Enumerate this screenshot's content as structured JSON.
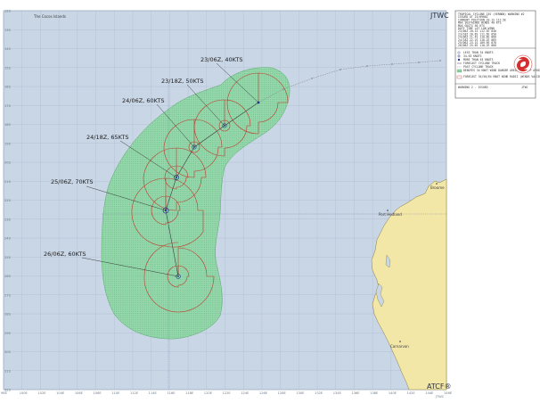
{
  "header": {
    "agency": "JTWC",
    "footer_brand": "ATCF®",
    "footer_sub": "JTWC",
    "region": "The Cocos Islands"
  },
  "colors": {
    "ocean": "#c9d6e6",
    "grid": "#a9b8cc",
    "land": "#f3e7a7",
    "wind_area": "#5fd07a",
    "forecast_track": "#3a3a3a",
    "past_track": "#8a8f96",
    "wind_radii": "#c0392b",
    "storm_marker": "#1e3a8a",
    "logo_red": "#d32f2f"
  },
  "forecast_points": [
    {
      "label": "23/06Z, 40KTS"
    },
    {
      "label": "23/18Z, 50KTS"
    },
    {
      "label": "24/06Z, 60KTS"
    },
    {
      "label": "24/18Z, 65KTS"
    },
    {
      "label": "25/06Z, 70KTS"
    },
    {
      "label": "26/06Z, 60KTS"
    }
  ],
  "places": {
    "port_hedland": "Port Hedland",
    "carnarvon": "Carnarvon",
    "broome": "Broome"
  },
  "lon_ticks": [
    "98E",
    "100E",
    "102E",
    "104E",
    "106E",
    "108E",
    "110E",
    "112E",
    "114E",
    "116E",
    "118E",
    "120E",
    "122E",
    "124E",
    "126E",
    "128E",
    "130E",
    "132E",
    "134E",
    "136E",
    "138E",
    "140E",
    "142E",
    "144E",
    "146E"
  ],
  "lat_ticks": [
    "12S",
    "13S",
    "14S",
    "15S",
    "16S",
    "17S",
    "18S",
    "19S",
    "20S",
    "21S",
    "22S",
    "23S",
    "24S",
    "25S",
    "26S",
    "27S",
    "28S",
    "29S",
    "30S",
    "31S",
    "32S"
  ],
  "info_box": {
    "title_lines": [
      "TROPICAL CYCLONE 23S (VERNON) WARNING #2",
      "ISSUED AT 23/0900Z",
      "CURRENT POSITION 20.1S 112.5E",
      "MAX SUSTAINED WINDS 40 KTS",
      "MAX GUSTS 50 KTS",
      "DATE TIME  LAT   LON   WIND",
      "23/06Z  20.1S 112.5E  040",
      "23/18Z  20.8S 111.6E  050",
      "24/06Z  21.4S 110.8E  060",
      "24/18Z  22.2S 110.2E  065",
      "25/06Z  23.1S 109.9E  070",
      "26/06Z  25.6S 110.2E  060"
    ],
    "legend": [
      "LESS THAN 34 KNOTS",
      "34-63 KNOTS",
      "MORE THAN 63 KNOTS",
      "FORECAST CYCLONE TRACK",
      "PAST CYCLONE TRACK",
      "DENOTES 34 KNOT WIND DANGER AREA/USN SHIP AVOIDANCE AREA",
      "FORECAST 34/50/64 KNOT WIND RADII (WINDS VALID OVER OPEN OCEAN ONLY)"
    ],
    "footer_left": "WARNING 2 - ISSUED",
    "footer_right": "JTWC"
  }
}
